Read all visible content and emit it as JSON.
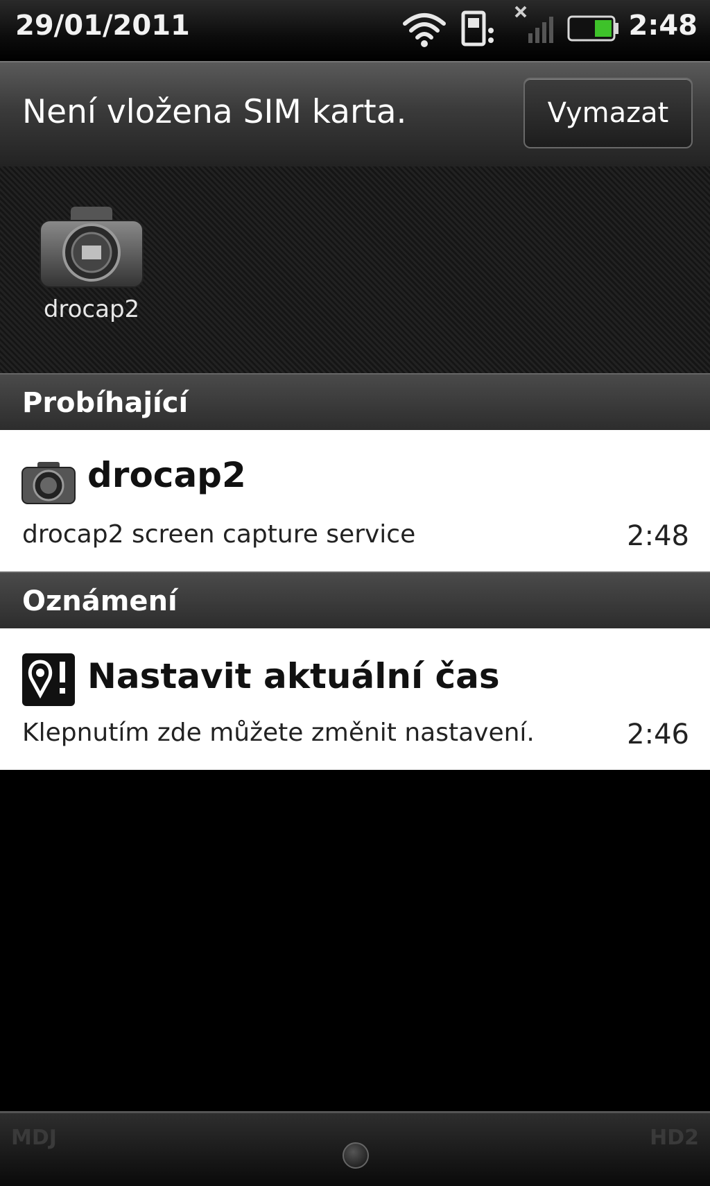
{
  "status_bar": {
    "date": "29/01/2011",
    "time": "2:48",
    "icons": [
      "wifi-icon",
      "sd-card-icon",
      "no-signal-icon",
      "battery-icon"
    ],
    "battery_color": "#3ec22a"
  },
  "header": {
    "title": "Není vložena SIM karta.",
    "clear_label": "Vymazat"
  },
  "shortcuts": [
    {
      "label": "drocap2",
      "icon": "camera-icon"
    }
  ],
  "sections": {
    "ongoing": {
      "label": "Probíhající",
      "items": [
        {
          "icon": "camera-icon",
          "title": "drocap2",
          "text": "drocap2 screen capture service",
          "time": "2:48"
        }
      ]
    },
    "notifications": {
      "label": "Oznámení",
      "items": [
        {
          "icon": "location-alert-icon",
          "title": "Nastavit aktuální čas",
          "text": "Klepnutím zde můžete změnit nastavení.",
          "time": "2:46"
        }
      ]
    }
  },
  "bottom_bar": {
    "left_text": "MDJ",
    "right_text": "HD2"
  }
}
